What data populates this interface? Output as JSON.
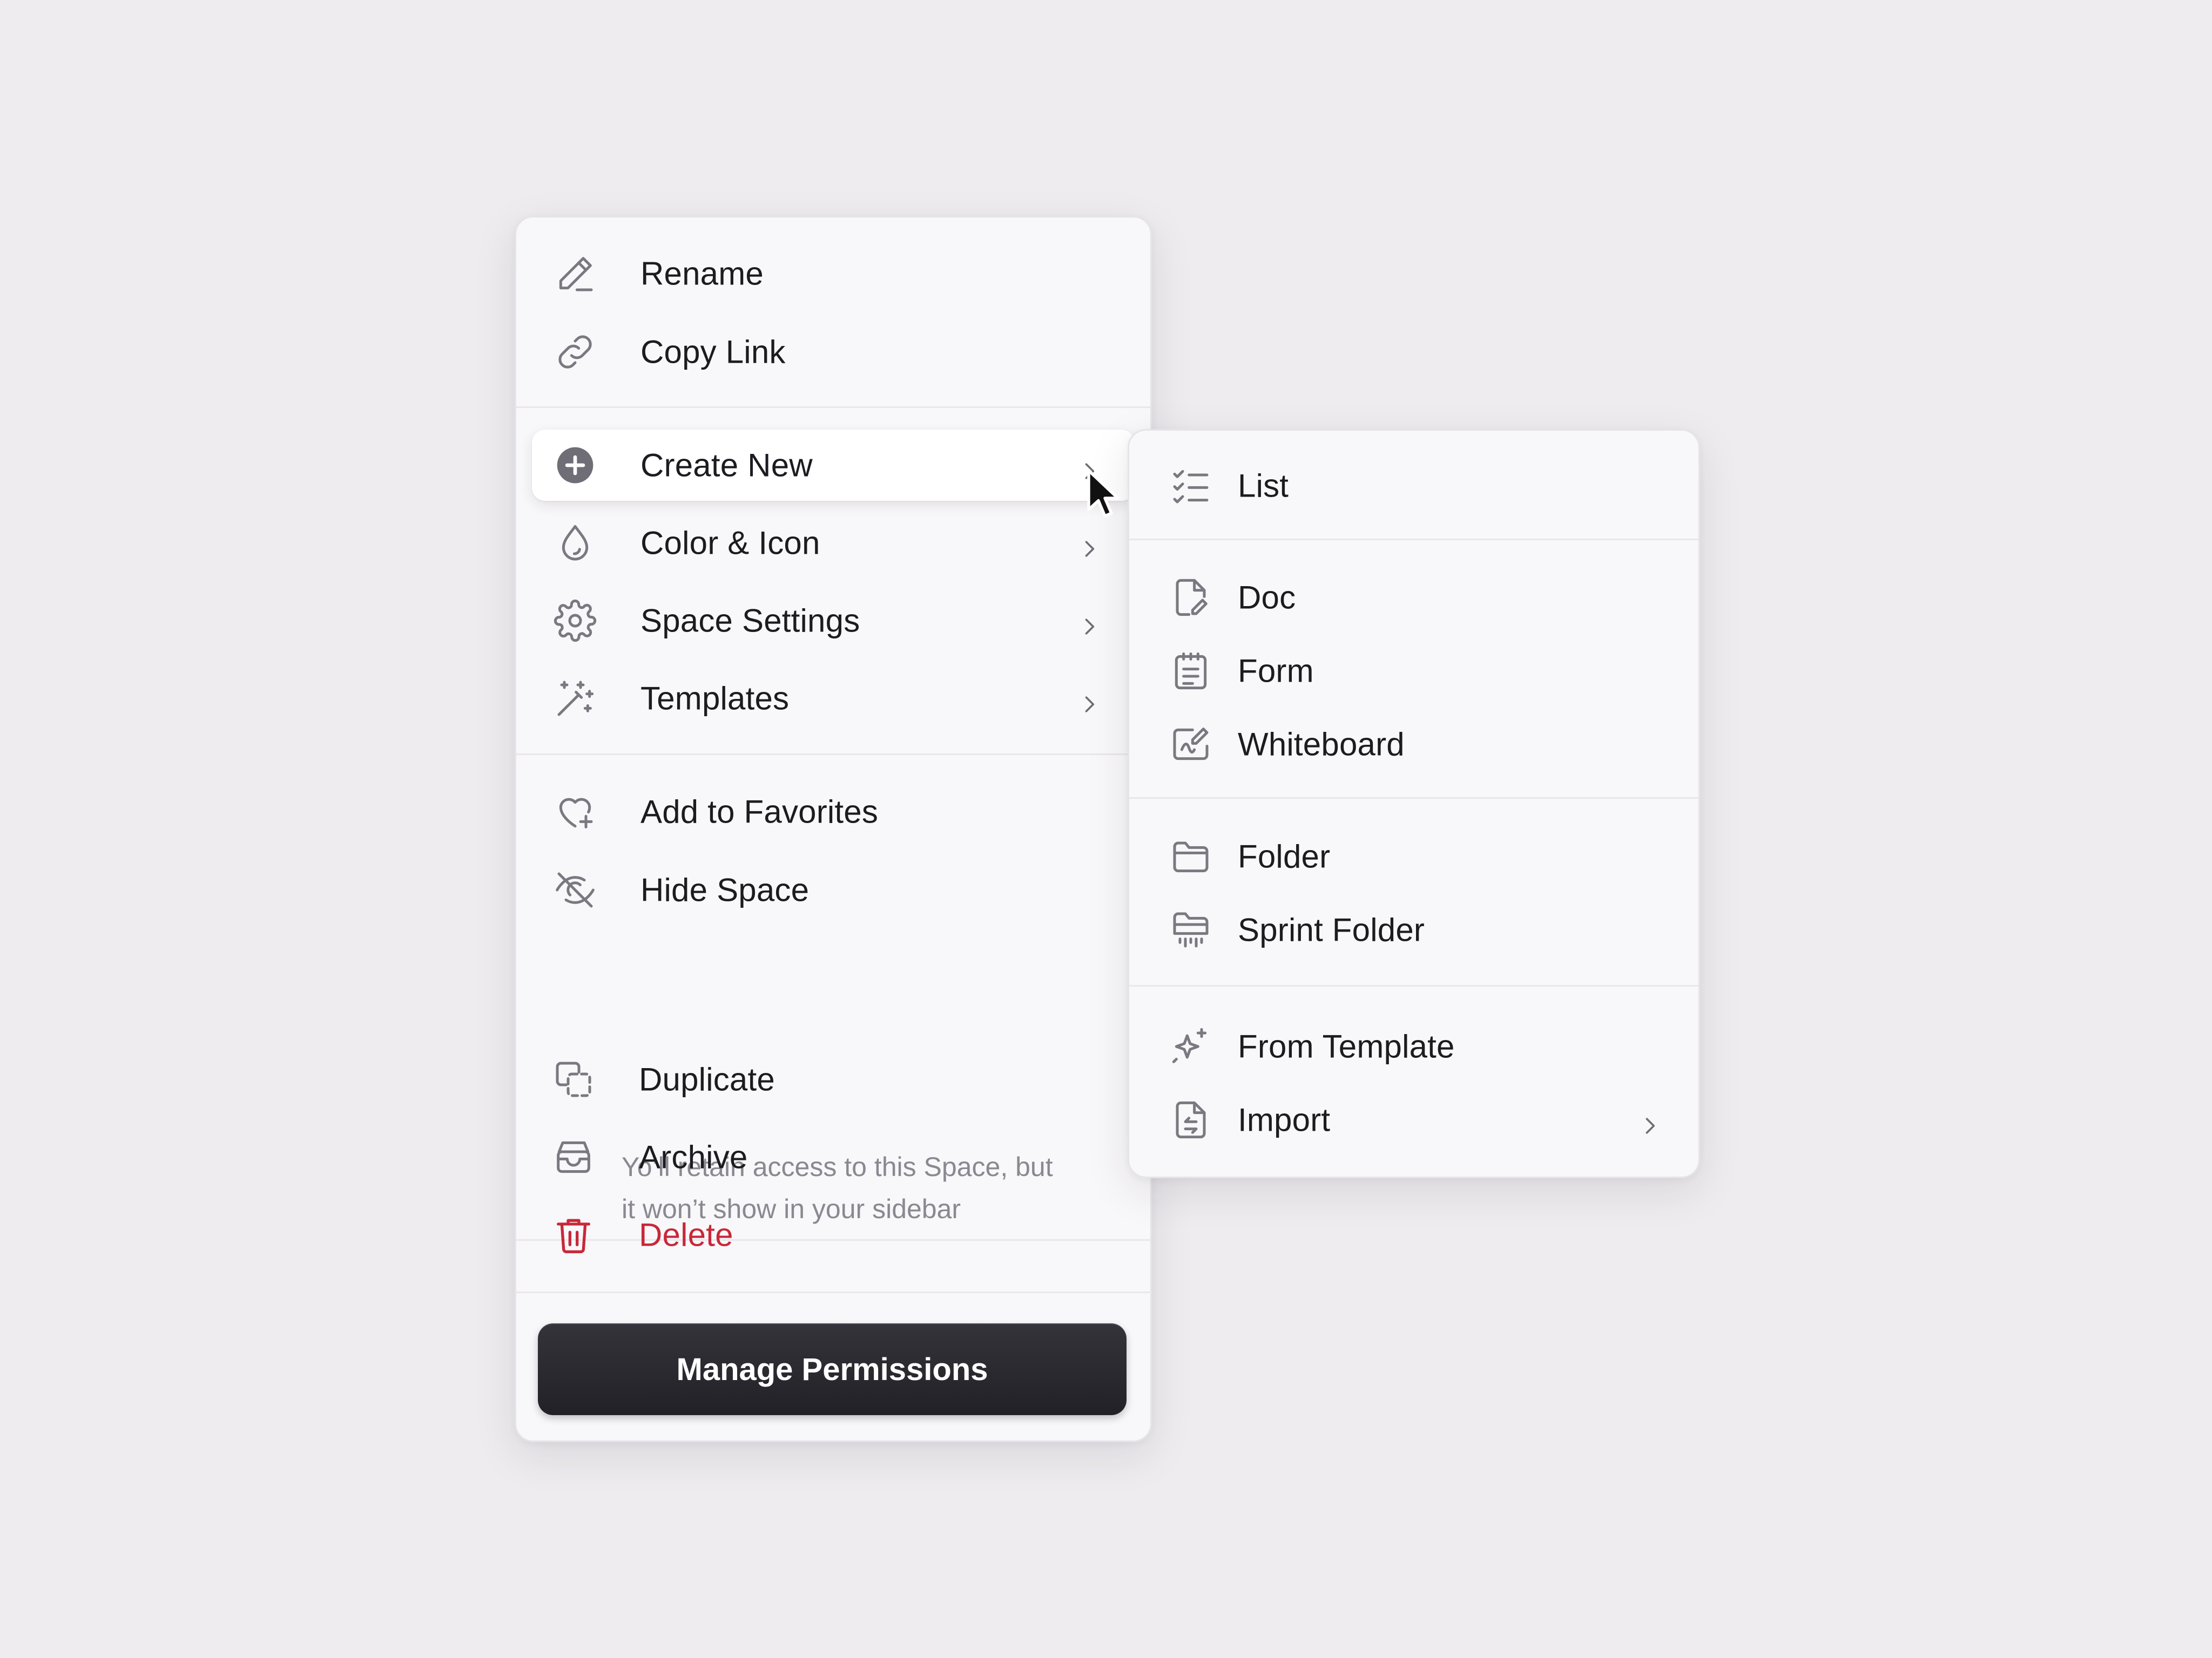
{
  "menu": {
    "rename_label": "Rename",
    "copy_link_label": "Copy Link",
    "create_new_label": "Create New",
    "color_icon_label": "Color & Icon",
    "space_settings_label": "Space Settings",
    "templates_label": "Templates",
    "add_favorites_label": "Add to Favorites",
    "hide_space_label": "Hide Space",
    "hide_space_hint_line1": "Yo’ll retain access to this Space, but",
    "hide_space_hint_line2": "it won’t show in your sidebar",
    "duplicate_label": "Duplicate",
    "archive_label": "Archive",
    "delete_label": "Delete",
    "manage_permissions_label": "Manage Permissions"
  },
  "submenu": {
    "list_label": "List",
    "doc_label": "Doc",
    "form_label": "Form",
    "whiteboard_label": "Whiteboard",
    "folder_label": "Folder",
    "sprint_folder_label": "Sprint Folder",
    "from_template_label": "From Template",
    "import_label": "Import"
  },
  "colors": {
    "background": "#eeecef",
    "panel": "#f8f7f9",
    "icon": "#7a7880",
    "danger": "#c8283a",
    "primary_button": "#2a292f"
  },
  "icons": {
    "rename": "pencil-icon",
    "copy_link": "link-icon",
    "create_new": "plus-circle-icon",
    "color_icon": "droplet-icon",
    "space_settings": "gear-icon",
    "templates": "magic-wand-icon",
    "add_favorites": "heart-plus-icon",
    "hide_space": "eye-off-icon",
    "duplicate": "duplicate-icon",
    "archive": "archive-box-icon",
    "delete": "trash-icon",
    "list": "checklist-icon",
    "doc": "document-icon",
    "form": "form-icon",
    "whiteboard": "whiteboard-icon",
    "folder": "folder-icon",
    "sprint_folder": "sprint-folder-icon",
    "from_template": "sparkles-icon",
    "import": "import-file-icon",
    "submenu_arrow": "chevron-right-icon",
    "pointer": "mouse-cursor-icon"
  }
}
